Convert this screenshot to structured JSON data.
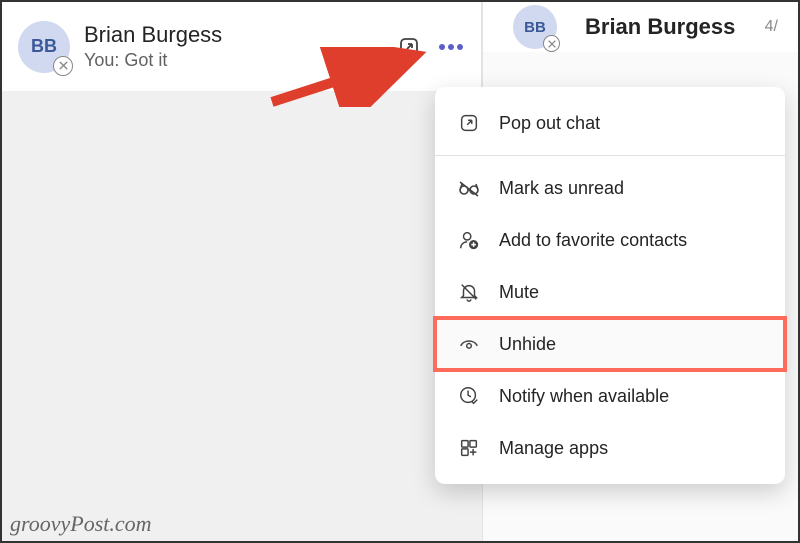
{
  "chat": {
    "avatar_initials": "BB",
    "name": "Brian Burgess",
    "preview": "You: Got it"
  },
  "right": {
    "avatar_initials": "BB",
    "name": "Brian Burgess",
    "date": "4/"
  },
  "menu": {
    "popout": "Pop out chat",
    "mark_unread": "Mark as unread",
    "add_favorite": "Add to favorite contacts",
    "mute": "Mute",
    "unhide": "Unhide",
    "notify": "Notify when available",
    "manage_apps": "Manage apps"
  },
  "watermark": "groovyPost.com"
}
